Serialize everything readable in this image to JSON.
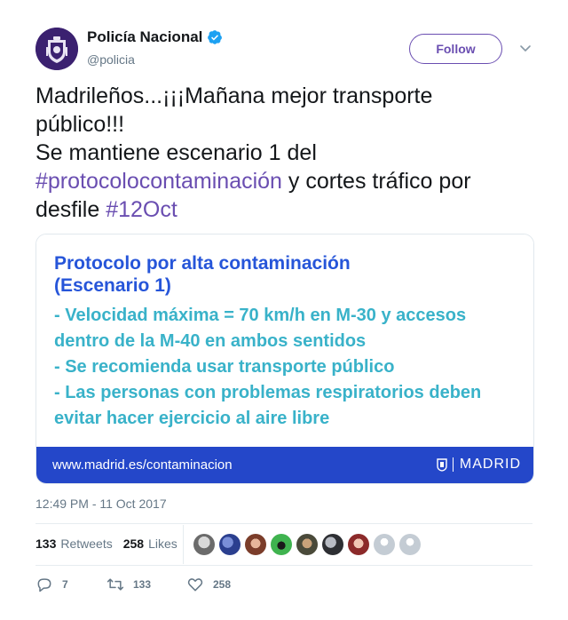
{
  "user": {
    "display_name": "Policía Nacional",
    "handle": "@policia",
    "verified": true,
    "avatar_icon": "police-shield-emblem"
  },
  "follow_button": {
    "label": "Follow"
  },
  "menu_icon": "chevron-down-icon",
  "tweet": {
    "line1": "Madrileños...¡¡¡Mañana mejor transporte",
    "line2": "público!!!",
    "line3": "Se mantiene escenario 1 del",
    "hashtag1": "#protocolocontaminación",
    "line4_rest": " y cortes tráfico por",
    "line5_start": "desfile ",
    "hashtag2": "#12Oct"
  },
  "card": {
    "title_line1": "Protocolo por alta contaminación",
    "title_line2": "(Escenario 1)",
    "items": [
      "- Velocidad máxima = 70 km/h en M-30 y accesos",
      "dentro de la M-40 en ambos sentidos",
      "- Se recomienda usar transporte público",
      "- Las personas con problemas respiratorios deben",
      "evitar hacer ejercicio al aire libre"
    ],
    "url": "www.madrid.es/contaminacion",
    "brand": "MADRID"
  },
  "timestamp": "12:49 PM - 11 Oct 2017",
  "stats": {
    "retweets_count": "133",
    "retweets_label": "Retweets",
    "likes_count": "258",
    "likes_label": "Likes"
  },
  "actions": {
    "reply_count": "7",
    "retweet_count": "133",
    "like_count": "258"
  },
  "colors": {
    "accent": "#6a4eb1",
    "card_title": "#2655d9",
    "card_text": "#39b2c9",
    "card_footer": "#2447c9",
    "verified": "#1da1f2"
  }
}
